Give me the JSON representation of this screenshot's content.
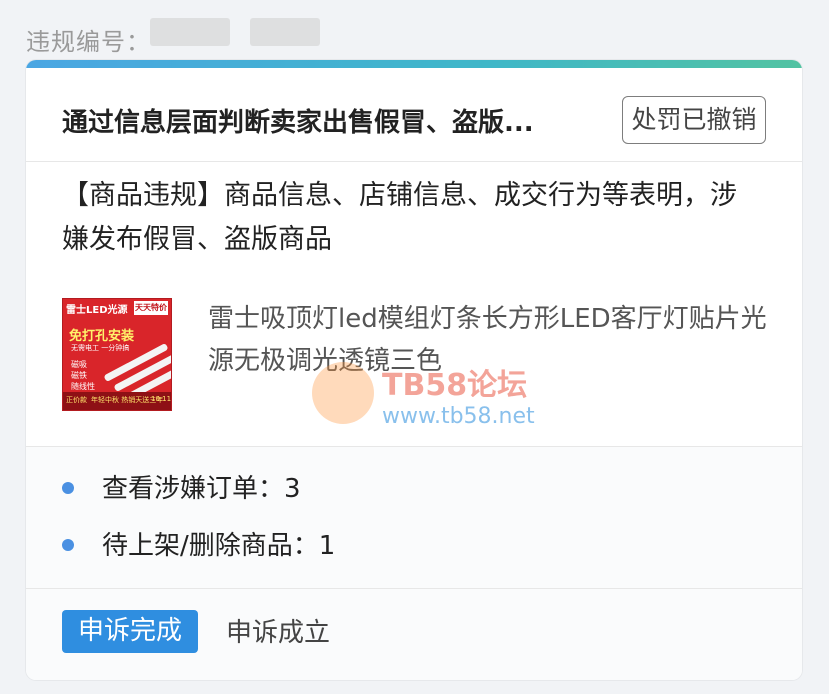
{
  "top": {
    "label": "违规编号："
  },
  "header": {
    "title": "通过信息层面判断卖家出售假冒、盗版...",
    "status": "处罚已撤销"
  },
  "description": "【商品违规】商品信息、店铺信息、成交行为等表明，涉嫌发布假冒、盗版商品",
  "product": {
    "name": "雷士吸顶灯led模组灯条长方形LED客厅灯贴片光源无极调光透镜三色",
    "thumb": {
      "brand": "雷士LED光源",
      "tag": "天天特价",
      "headline": "免打孔安装",
      "sub": "无需电工 一分钟搞",
      "features": [
        "磁吸",
        "磁铁",
        "随线性"
      ],
      "footer_left": "正价款",
      "footer_mid": "年轻中秋 热销天送三年",
      "footer_right": "10.11"
    }
  },
  "watermark": {
    "brand": "TB58论坛",
    "url": "www.tb58.net"
  },
  "stats": [
    {
      "label": "查看涉嫌订单：3"
    },
    {
      "label": "待上架/删除商品：1"
    }
  ],
  "footer": {
    "badge": "申诉完成",
    "result": "申诉成立"
  },
  "colors": {
    "accent": "#2f8ee0",
    "bullet": "#4a90e2",
    "strip_start": "#4aa6e3",
    "strip_end": "#52c3a2"
  }
}
